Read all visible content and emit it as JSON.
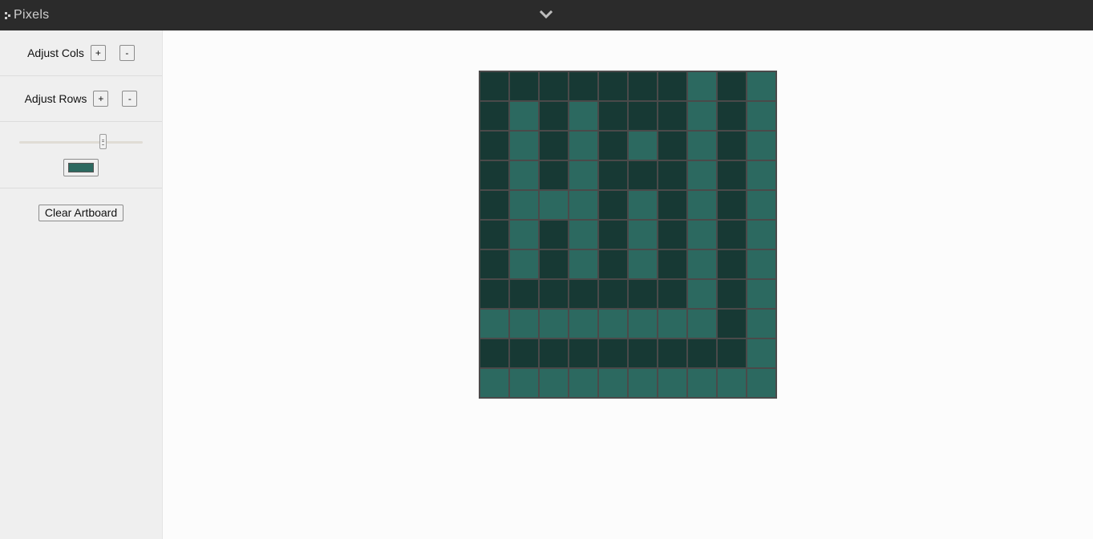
{
  "header": {
    "brand": "Pixels",
    "menu_toggle_icon": "chevron-down-icon"
  },
  "sidebar": {
    "cols_label": "Adjust Cols",
    "rows_label": "Adjust Rows",
    "increment_label": "+",
    "decrement_label": "-",
    "size_slider": {
      "min": 0,
      "max": 1,
      "value": 0.69
    },
    "selected_color": "#2c6960",
    "clear_label": "Clear Artboard"
  },
  "palette": {
    "dark": "#173934",
    "light": "#2c6960",
    "grid_line": "#4a4a4a"
  },
  "artboard": {
    "cols": 10,
    "rows": 11,
    "pixels": [
      [
        0,
        0,
        0,
        0,
        0,
        0,
        0,
        1,
        0,
        1
      ],
      [
        0,
        1,
        0,
        1,
        0,
        0,
        0,
        1,
        0,
        1
      ],
      [
        0,
        1,
        0,
        1,
        0,
        1,
        0,
        1,
        0,
        1
      ],
      [
        0,
        1,
        0,
        1,
        0,
        0,
        0,
        1,
        0,
        1
      ],
      [
        0,
        1,
        1,
        1,
        0,
        1,
        0,
        1,
        0,
        1
      ],
      [
        0,
        1,
        0,
        1,
        0,
        1,
        0,
        1,
        0,
        1
      ],
      [
        0,
        1,
        0,
        1,
        0,
        1,
        0,
        1,
        0,
        1
      ],
      [
        0,
        0,
        0,
        0,
        0,
        0,
        0,
        1,
        0,
        1
      ],
      [
        1,
        1,
        1,
        1,
        1,
        1,
        1,
        1,
        0,
        1
      ],
      [
        0,
        0,
        0,
        0,
        0,
        0,
        0,
        0,
        0,
        1
      ],
      [
        1,
        1,
        1,
        1,
        1,
        1,
        1,
        1,
        1,
        1
      ]
    ]
  }
}
